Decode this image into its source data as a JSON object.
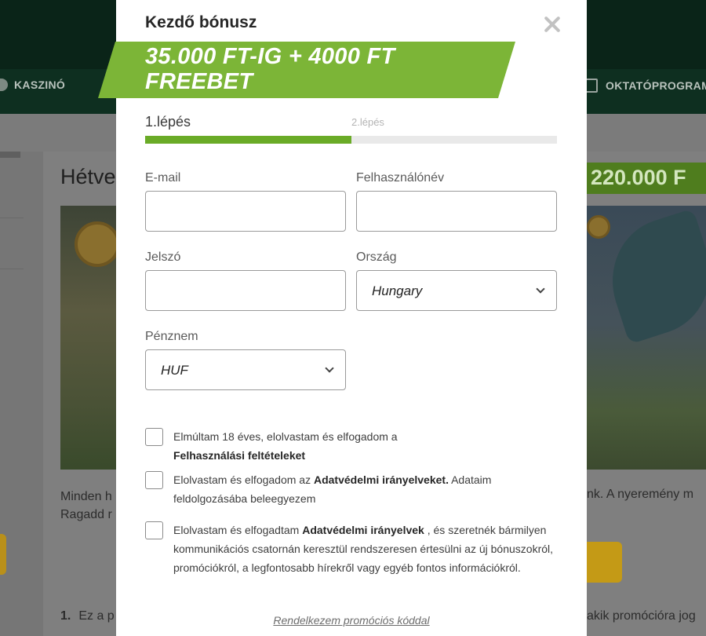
{
  "background": {
    "nav": {
      "left_label": "KASZINÓ",
      "right_label": "OKTATÓPROGRAM"
    },
    "promo_title": "Hétve",
    "promo_amount": "220.000 F",
    "text_left_line1": "Minden h",
    "text_left_line2": "Ragadd r",
    "text_right": "nk. A nyeremény m",
    "list_number": "1.",
    "list_left": "Ez a p",
    "list_right": "akik promócióra jog"
  },
  "modal": {
    "title": "Kezdő bónusz",
    "banner": "35.000 FT-IG + 4000 FT FREEBET",
    "steps": {
      "step1": "1.lépés",
      "step2": "2.lépés",
      "progress": 0.5
    },
    "fields": {
      "email": {
        "label": "E-mail",
        "value": ""
      },
      "username": {
        "label": "Felhasználónév",
        "value": ""
      },
      "password": {
        "label": "Jelszó",
        "value": ""
      },
      "country": {
        "label": "Ország",
        "value": "Hungary"
      },
      "currency": {
        "label": "Pénznem",
        "value": "HUF"
      }
    },
    "checkboxes": [
      {
        "text_a": "Elmúltam 18 éves, elolvastam és elfogadom a ",
        "bold_a": "Felhasználási feltételeket",
        "text_b": "",
        "bold_b": "",
        "text_c": "",
        "checked": false
      },
      {
        "text_a": "Elolvastam és elfogadom az ",
        "bold_a": "Adatvédelmi irányelveket.",
        "text_b": " Adataim feldolgozásába beleegyezem",
        "bold_b": "",
        "text_c": "",
        "checked": false
      },
      {
        "text_a": "Elolvastam és elfogadtam ",
        "bold_a": "Adatvédelmi irányelvek",
        "text_b": " , és szeretnék bármilyen kommunikációs csatornán keresztül rendszeresen értesülni az új bónuszokról, promóciókról, a legfontosabb hírekről vagy egyéb fontos információkról.",
        "bold_b": "",
        "text_c": "",
        "checked": false
      }
    ],
    "promo_code_link": "Rendelkezem promóciós kóddal"
  },
  "colors": {
    "accent_green": "#7cb537",
    "progress_green": "#6aab27",
    "header_dark": "#0a2418"
  }
}
